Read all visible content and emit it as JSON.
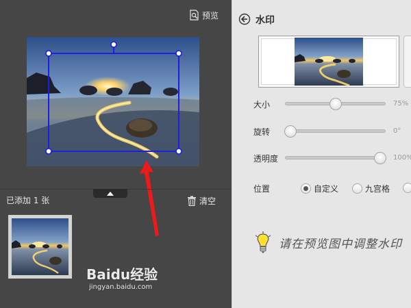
{
  "left_panel": {
    "preview_label": "预览",
    "added_count_text": "已添加 1 张",
    "clear_label": "清空"
  },
  "right_panel": {
    "title": "水印",
    "sliders": [
      {
        "label": "大小",
        "value_text": "75%",
        "level_pct": 50
      },
      {
        "label": "旋转",
        "value_text": "0°",
        "level_pct": 5
      },
      {
        "label": "透明度",
        "value_text": "100%",
        "level_pct": 95
      }
    ],
    "position": {
      "label": "位置",
      "options": [
        {
          "label": "自定义",
          "selected": true
        },
        {
          "label": "九宫格",
          "selected": false
        }
      ]
    },
    "tip_text": "请在预览图中调整水印"
  },
  "watermark_overlay": {
    "brand": "Baidu经验",
    "site": "jingyan.baidu.com"
  },
  "colors": {
    "handle_blue": "#1a1fe0",
    "arrow_red": "#ee1a1a",
    "dark_bg": "#464646",
    "panel_bg": "#e6e6e6"
  },
  "icons": [
    "preview-icon",
    "trash-icon",
    "back-arrow-icon",
    "lightbulb-icon",
    "caret-up-icon"
  ]
}
